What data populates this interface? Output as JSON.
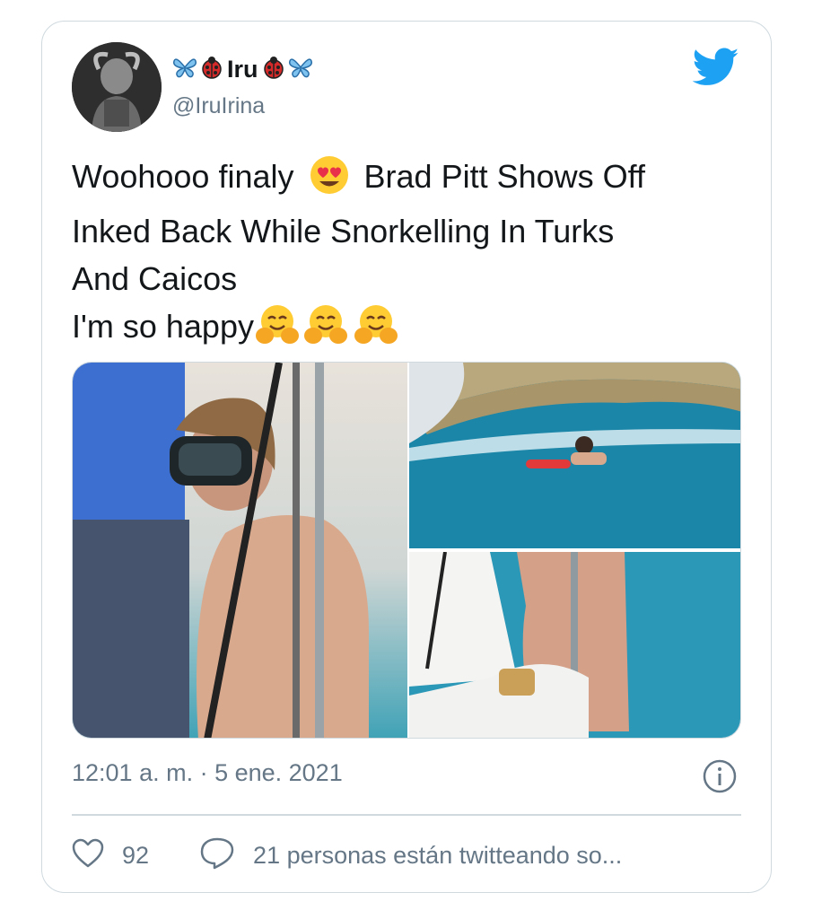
{
  "tweet": {
    "display_name": "Iru",
    "name_decorations": [
      "butterfly-icon",
      "ladybug-icon",
      "ladybug-icon",
      "butterfly-icon"
    ],
    "handle": "@IruIrina",
    "text_lines": [
      "Woohooo finaly",
      "Brad Pitt Shows Off",
      "Inked Back While Snorkelling In Turks",
      "And Caicos",
      "I'm so happy"
    ],
    "emojis": [
      "heart-eyes-emoji",
      "hugging-face-emoji",
      "hugging-face-emoji",
      "hugging-face-emoji"
    ],
    "timestamp": "12:01 a. m. · 5 ene. 2021",
    "likes": "92",
    "retweeting_text": "21 personas están twitteando so..."
  },
  "colors": {
    "twitter_blue": "#1da1f2",
    "secondary_text": "#657786",
    "border": "#cfd9de"
  }
}
